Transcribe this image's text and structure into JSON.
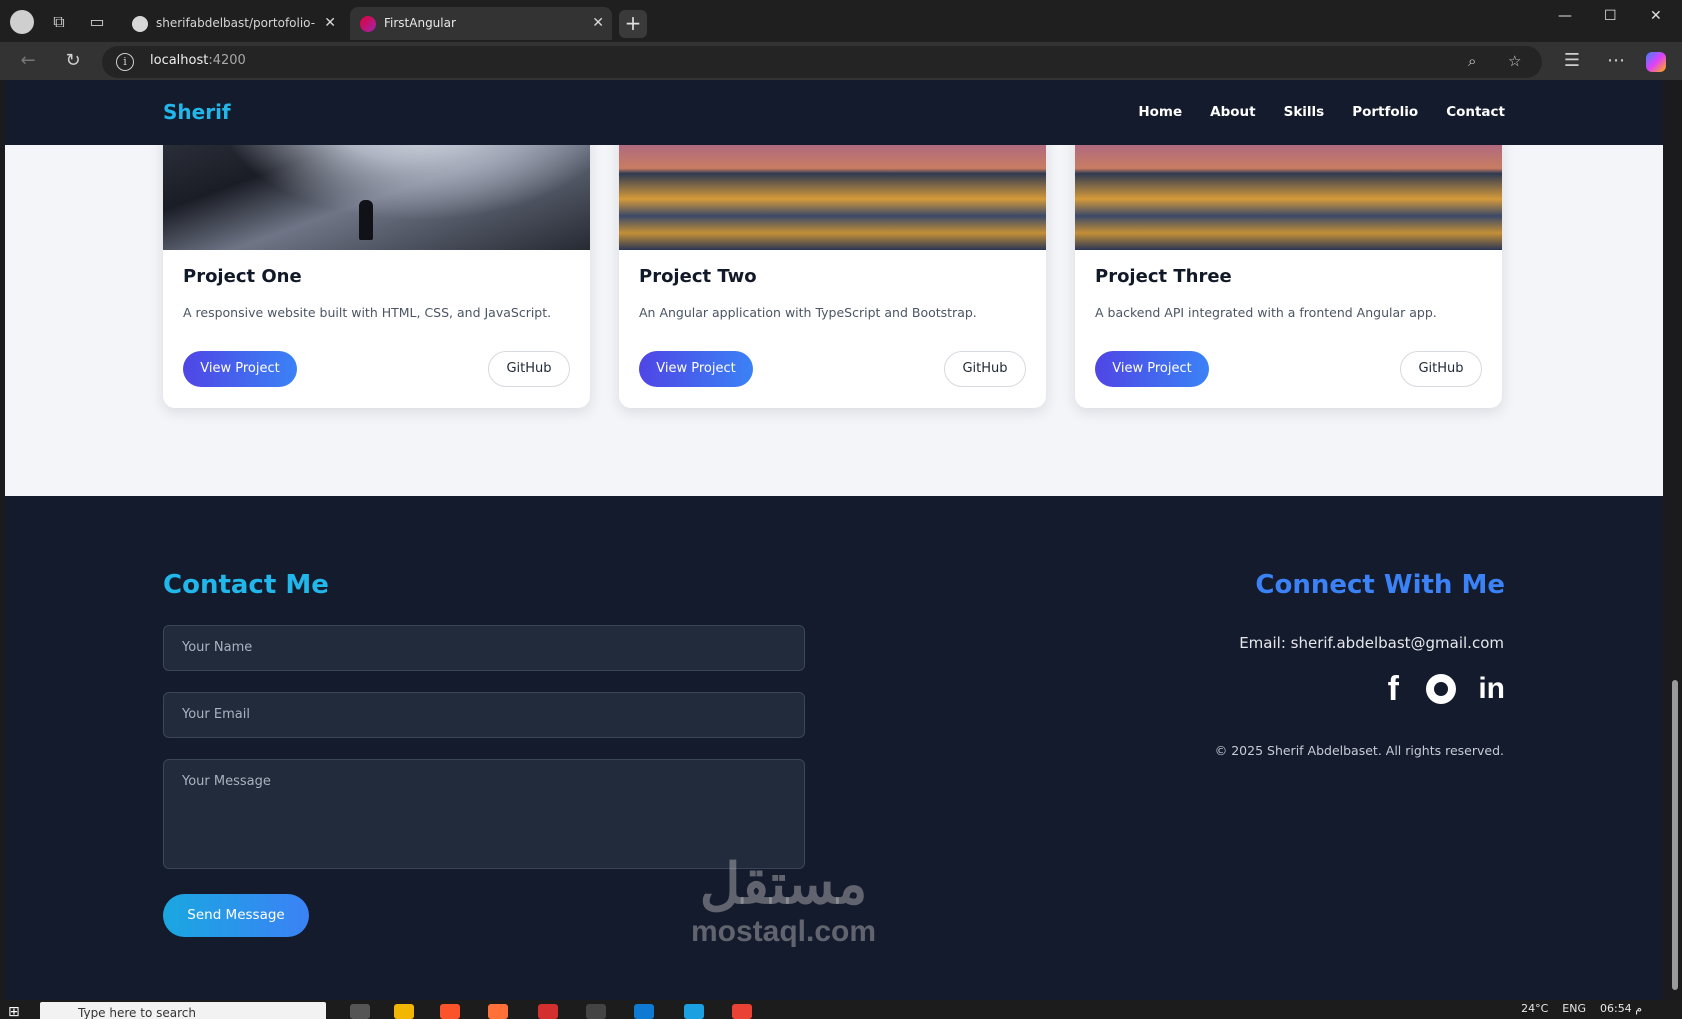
{
  "browser": {
    "tabs": [
      {
        "title": "sherifabdelbast/portofolio-",
        "active": false
      },
      {
        "title": "FirstAngular",
        "active": true
      }
    ],
    "url_host": "localhost",
    "url_port": ":4200"
  },
  "site": {
    "brand": "Sherif",
    "nav": [
      "Home",
      "About",
      "Skills",
      "Portfolio",
      "Contact"
    ]
  },
  "projects": [
    {
      "title": "Project One",
      "description": "A responsive website built with HTML, CSS, and JavaScript.",
      "view_label": "View Project",
      "github_label": "GitHub"
    },
    {
      "title": "Project Two",
      "description": "An Angular application with TypeScript and Bootstrap.",
      "view_label": "View Project",
      "github_label": "GitHub"
    },
    {
      "title": "Project Three",
      "description": "A backend API integrated with a frontend Angular app.",
      "view_label": "View Project",
      "github_label": "GitHub"
    }
  ],
  "contact": {
    "title": "Contact Me",
    "name_placeholder": "Your Name",
    "email_placeholder": "Your Email",
    "message_placeholder": "Your Message",
    "send_label": "Send Message"
  },
  "connect": {
    "title": "Connect With Me",
    "email_line": "Email: sherif.abdelbast@gmail.com",
    "socials": [
      "facebook-icon",
      "github-icon",
      "linkedin-icon"
    ],
    "copyright": "© 2025 Sherif Abdelbaset. All rights reserved."
  },
  "watermark": {
    "arabic": "مستقل",
    "latin": "mostaql.com"
  },
  "taskbar": {
    "search_placeholder": "Type here to search",
    "clock": "06:54 م",
    "lang": "ENG",
    "temp": "24°C"
  },
  "colors": {
    "accent": "#22b7ea",
    "footer_bg": "#141b2d",
    "button_gradient_start": "#4f46e5",
    "button_gradient_end": "#3b82f6"
  }
}
